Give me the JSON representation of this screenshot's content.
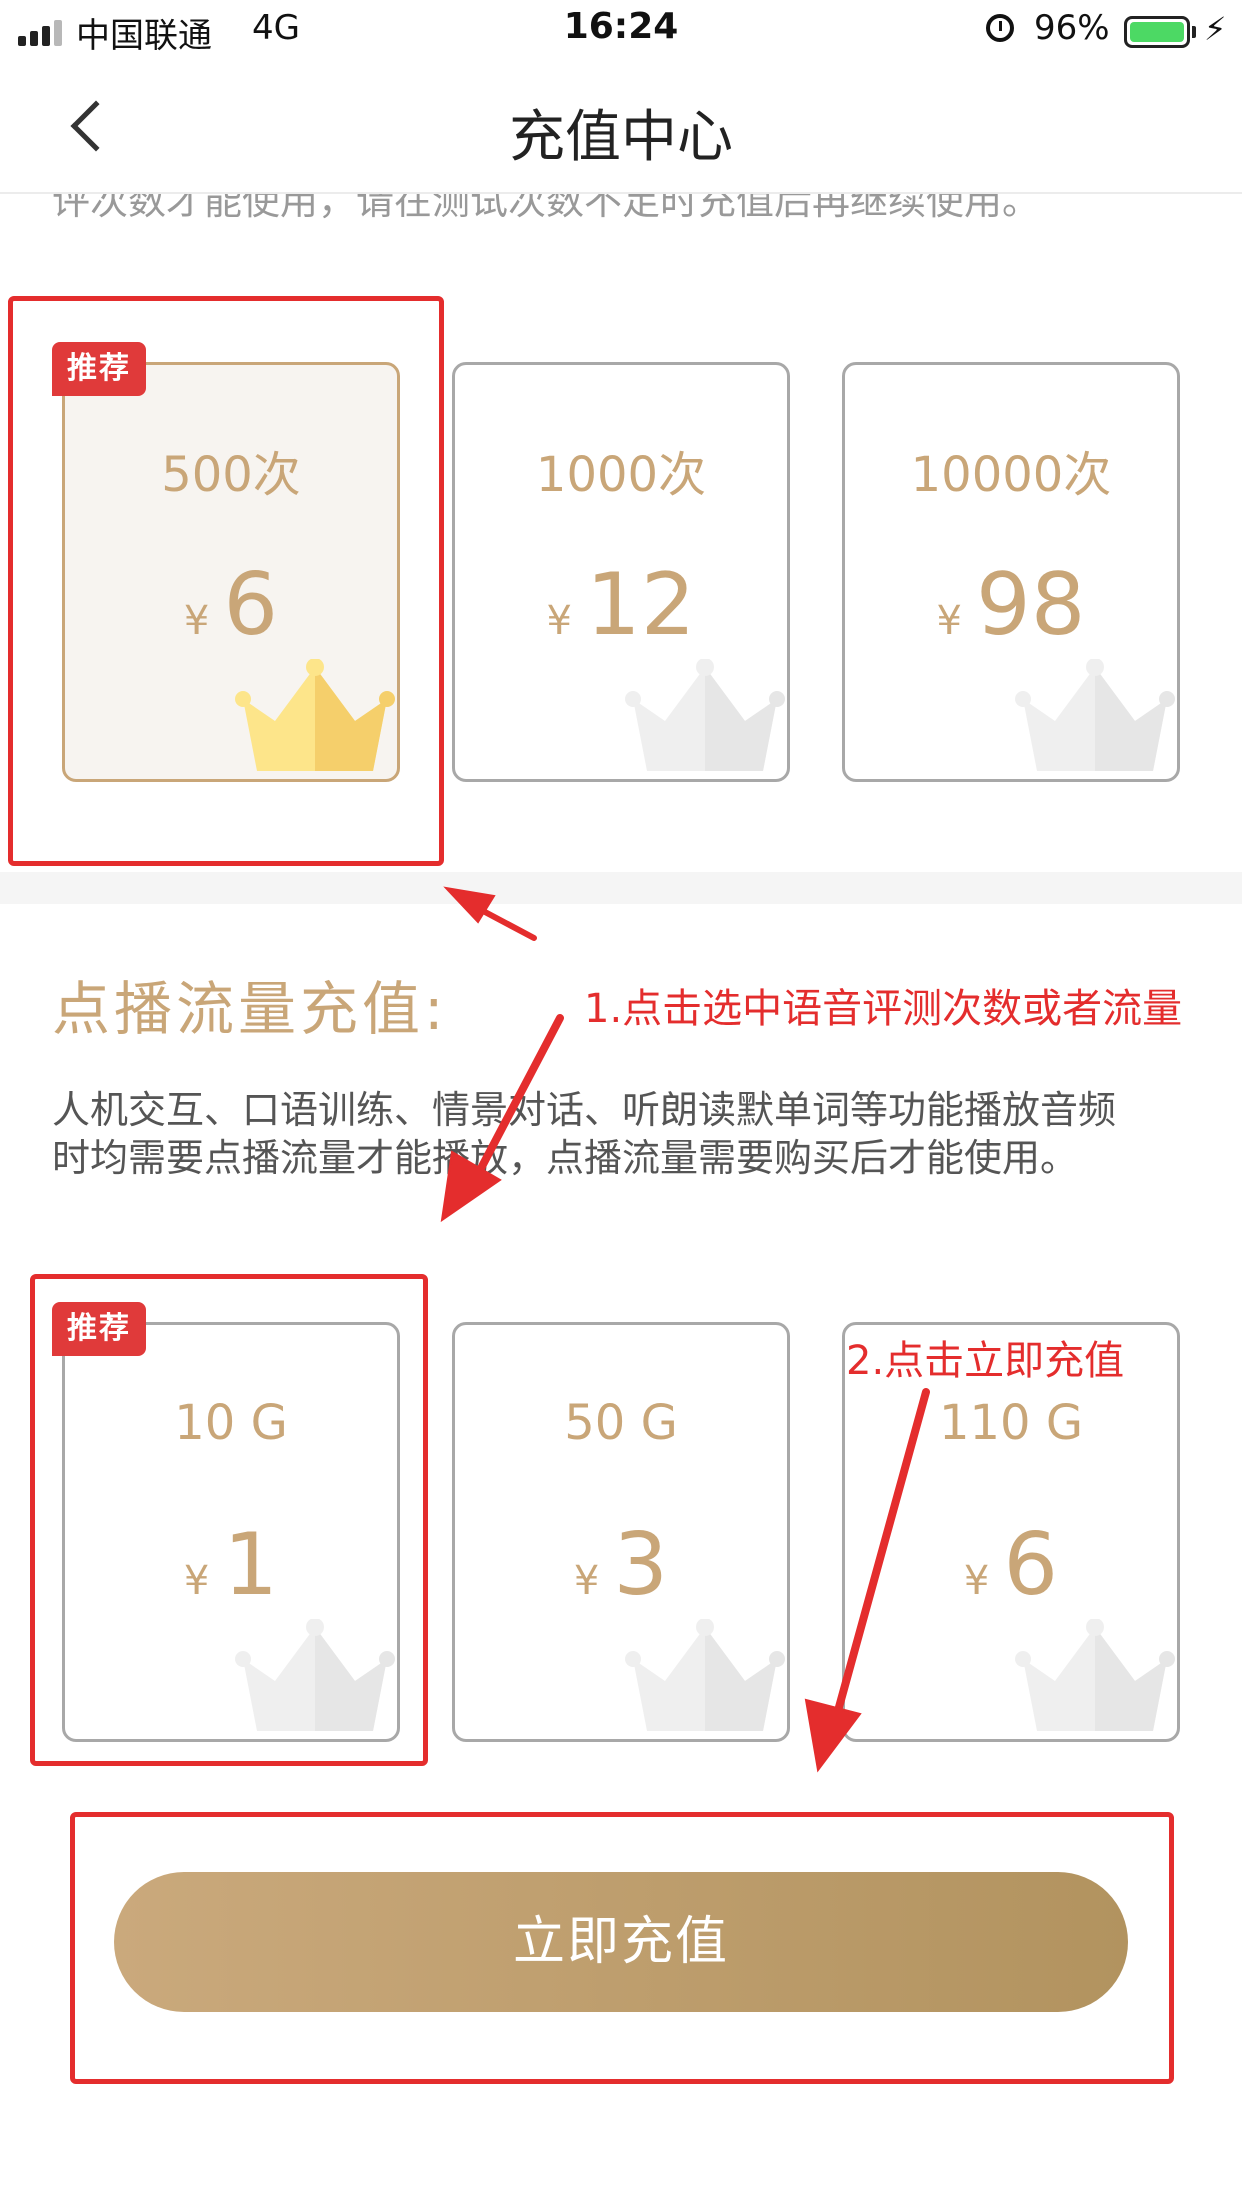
{
  "status_bar": {
    "carrier": "中国联通",
    "network": "4G",
    "time": "16:24",
    "battery": "96%",
    "battery_level": 0.96,
    "icons": [
      "signal-icon",
      "alarm-icon",
      "battery-icon",
      "charging-bolt-icon"
    ]
  },
  "nav": {
    "title": "充值中心",
    "back_icon": "chevron-left-icon"
  },
  "cut_text": "评次数才能使用，请在测试次数不足时充值后再继续使用。",
  "badge_label": "推荐",
  "test_packages": [
    {
      "qty": "500次",
      "currency": "¥",
      "price": "6",
      "selected": true,
      "recommended": true
    },
    {
      "qty": "1000次",
      "currency": "¥",
      "price": "12",
      "selected": false,
      "recommended": false
    },
    {
      "qty": "10000次",
      "currency": "¥",
      "price": "98",
      "selected": false,
      "recommended": false
    }
  ],
  "traffic_section": {
    "heading": "点播流量充值:",
    "desc_line1": "人机交互、口语训练、情景对话、听朗读默单词等功能播放音频",
    "desc_line2": "时均需要点播流量才能播放，点播流量需要购买后才能使用。"
  },
  "traffic_packages": [
    {
      "qty": "10 G",
      "currency": "¥",
      "price": "1",
      "selected": false,
      "recommended": true
    },
    {
      "qty": "50 G",
      "currency": "¥",
      "price": "3",
      "selected": false,
      "recommended": false
    },
    {
      "qty": "110 G",
      "currency": "¥",
      "price": "6",
      "selected": false,
      "recommended": false
    }
  ],
  "recharge_button": "立即充值",
  "annotations": {
    "step1": "1.点击选中语音评测次数或者流量",
    "step2": "2.点击立即充值",
    "color": "#e42d2d"
  },
  "colors": {
    "accent_gold": "#c9a678",
    "badge_red": "#e03a3a",
    "battery_green": "#4cd964"
  }
}
